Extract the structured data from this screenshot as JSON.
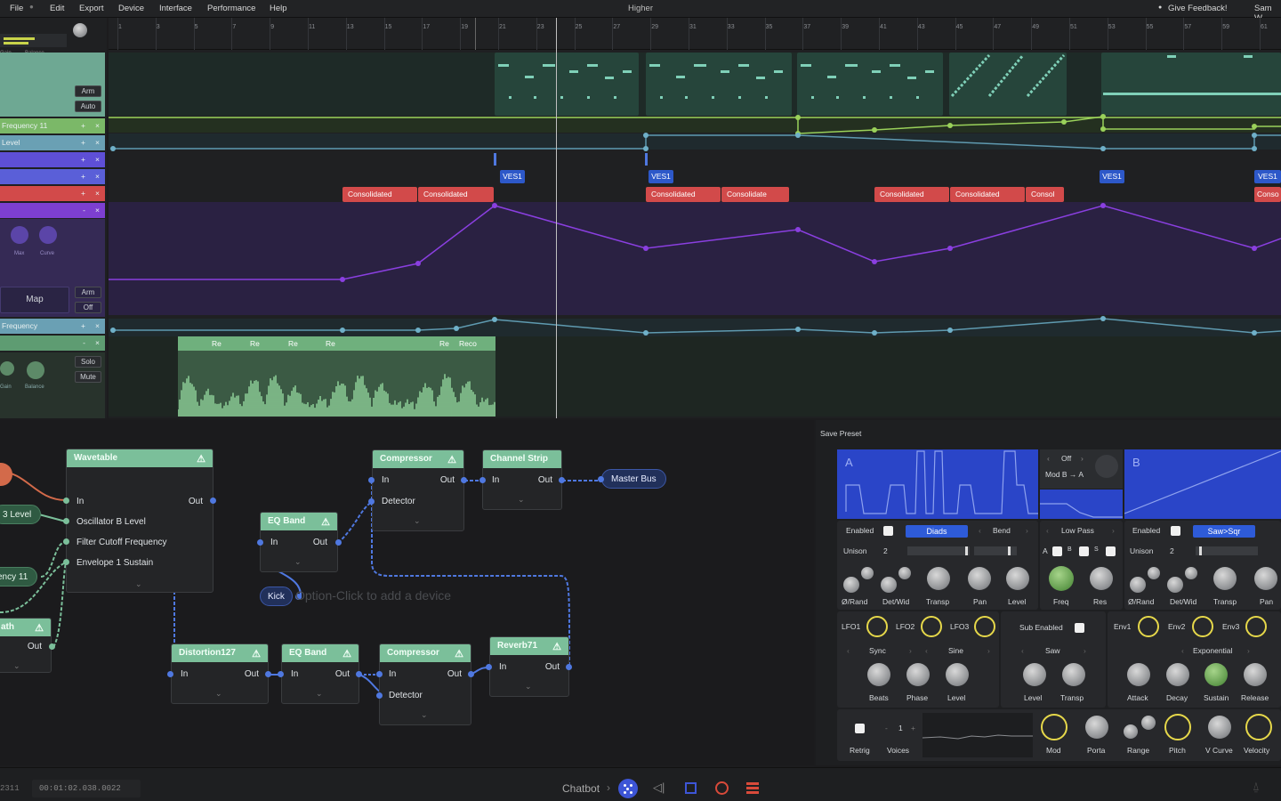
{
  "menu": {
    "items": [
      "File",
      "Edit",
      "Export",
      "Device",
      "Interface",
      "Performance",
      "Help"
    ],
    "project_title": "Higher",
    "feedback": "Give Feedback!",
    "user": "Sam W"
  },
  "ruler": {
    "ticks": [
      "1",
      "3",
      "5",
      "7",
      "9",
      "11",
      "13",
      "15",
      "17",
      "19",
      "21",
      "23",
      "25",
      "27",
      "29",
      "31",
      "33",
      "35",
      "37",
      "39",
      "41",
      "43",
      "45",
      "47",
      "49",
      "51",
      "53",
      "55",
      "57",
      "59",
      "61"
    ]
  },
  "tracks": {
    "t1": {
      "gain": "Gain",
      "balance": "Balance",
      "arm": "Arm",
      "auto": "Auto"
    },
    "rows": [
      {
        "label": "Frequency 11",
        "plus": "+",
        "x": "×"
      },
      {
        "label": "Level",
        "plus": "+",
        "x": "×"
      },
      {
        "label": "",
        "plus": "+",
        "x": "×"
      },
      {
        "label": "",
        "plus": "+",
        "x": "×"
      },
      {
        "label": "",
        "plus": "+",
        "x": "×"
      },
      {
        "label": "",
        "plus": "-",
        "x": "×"
      }
    ],
    "map": {
      "knob1": "Max",
      "knob2": "Curve",
      "label": "Map",
      "arm": "Arm",
      "off": "Off"
    },
    "freq_row": {
      "label": "Frequency",
      "plus": "+",
      "x": "×"
    },
    "audio_row": {
      "plus": "-",
      "x": "×",
      "solo": "Solo",
      "mute": "Mute",
      "gain": "Gain",
      "balance": "Balance"
    }
  },
  "clips": {
    "consolidated": [
      "Consolidated",
      "Consolidated",
      "Consolidated",
      "Consolidate",
      "Consolidated",
      "Consolidated",
      "Consol",
      "Conso"
    ],
    "ves": [
      "VES1",
      "VES1",
      "VES1",
      "VES1"
    ],
    "audio_labels": [
      "Re",
      "Re",
      "Re",
      "Re",
      "Re",
      "Reco"
    ]
  },
  "nodes": {
    "wavetable": {
      "title": "Wavetable",
      "in": "In",
      "out": "Out",
      "params": [
        "Oscillator B Level",
        "Filter Cutoff Frequency",
        "Envelope 1 Sustain"
      ]
    },
    "eq1": {
      "title": "EQ Band",
      "in": "In",
      "out": "Out"
    },
    "comp1": {
      "title": "Compressor",
      "in": "In",
      "out": "Out",
      "detector": "Detector"
    },
    "channel": {
      "title": "Channel Strip",
      "in": "In",
      "out": "Out"
    },
    "master": "Master Bus",
    "kick": "Kick",
    "hint": "Option-Click to add a device",
    "dist": {
      "title": "Distortion127",
      "in": "In",
      "out": "Out"
    },
    "eq2": {
      "title": "EQ Band",
      "in": "In",
      "out": "Out"
    },
    "comp2": {
      "title": "Compressor",
      "in": "In",
      "out": "Out",
      "detector": "Detector"
    },
    "reverb": {
      "title": "Reverb71",
      "in": "In",
      "out": "Out"
    },
    "left_pills": [
      "3 Level",
      "ency 11"
    ],
    "math": {
      "title": "ath",
      "out": "Out"
    }
  },
  "synth": {
    "save_preset": "Save Preset",
    "osc_a": {
      "label": "A",
      "enabled": "Enabled",
      "mode": "Diads",
      "bend": "Bend",
      "unison": "Unison",
      "unison_val": "2",
      "knobs": [
        "Ø/Rand",
        "Det/Wid",
        "Transp",
        "Pan",
        "Level"
      ]
    },
    "mod": {
      "off": "Off",
      "route": "Mod B → A"
    },
    "filter": {
      "type": "Low Pass",
      "a": "A",
      "b": "B",
      "s": "S",
      "knobs": [
        "Freq",
        "Res"
      ]
    },
    "osc_b": {
      "label": "B",
      "enabled": "Enabled",
      "mode": "Saw>Sqr",
      "unison": "Unison",
      "unison_val": "2",
      "knobs": [
        "Ø/Rand",
        "Det/Wid",
        "Transp",
        "Pan"
      ]
    },
    "lfos": [
      "LFO1",
      "LFO2",
      "LFO3"
    ],
    "lfo_params": {
      "sync": "Sync",
      "shape": "Sine",
      "knobs": [
        "Beats",
        "Phase",
        "Level"
      ]
    },
    "sub": {
      "enabled": "Sub Enabled",
      "shape": "Saw",
      "knobs": [
        "Level",
        "Transp"
      ]
    },
    "envs": [
      "Env1",
      "Env2",
      "Env3"
    ],
    "env_params": {
      "curve": "Exponential",
      "knobs": [
        "Attack",
        "Decay",
        "Sustain",
        "Release"
      ]
    },
    "bottom": {
      "retrig": "Retrig",
      "voices": "Voices",
      "voices_val": "1",
      "mod": "Mod",
      "porta": "Porta",
      "range": "Range",
      "pitch": "Pitch",
      "vcurve": "V Curve",
      "velocity": "Velocity"
    }
  },
  "status": {
    "left": "2311",
    "time": "00:01:02.038.0022",
    "chatbot": "Chatbot"
  }
}
